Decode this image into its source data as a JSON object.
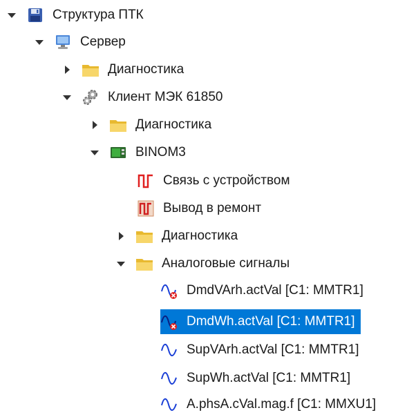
{
  "tree": {
    "root": {
      "label": "Структура ПТК",
      "icon": "save-icon"
    },
    "server": {
      "label": "Сервер",
      "icon": "computer-icon"
    },
    "server_diag": {
      "label": "Диагностика",
      "icon": "folder-icon"
    },
    "client": {
      "label": "Клиент МЭК 61850",
      "icon": "gear-icon"
    },
    "client_diag": {
      "label": "Диагностика",
      "icon": "folder-icon"
    },
    "device": {
      "label": "BINOM3",
      "icon": "device-icon"
    },
    "link": {
      "label": "Связь с устройством",
      "icon": "signal-icon"
    },
    "repair": {
      "label": "Вывод в ремонт",
      "icon": "repair-icon"
    },
    "device_diag": {
      "label": "Диагностика",
      "icon": "folder-icon"
    },
    "analog": {
      "label": "Аналоговые сигналы",
      "icon": "folder-icon"
    },
    "signals": [
      {
        "label": "DmdVArh.actVal [C1: MMTR1]",
        "icon": "analog-error-icon"
      },
      {
        "label": "DmdWh.actVal [C1: MMTR1]",
        "icon": "analog-error-icon",
        "selected": true
      },
      {
        "label": "SupVArh.actVal [C1: MMTR1]",
        "icon": "analog-icon"
      },
      {
        "label": "SupWh.actVal [C1: MMTR1]",
        "icon": "analog-icon"
      },
      {
        "label": "A.phsA.cVal.mag.f [C1: MMXU1]",
        "icon": "analog-icon"
      }
    ]
  },
  "colors": {
    "selection": "#0078d7",
    "folder": "#f5c842",
    "signal_red": "#e02020",
    "wave_blue": "#1a3fd6"
  }
}
